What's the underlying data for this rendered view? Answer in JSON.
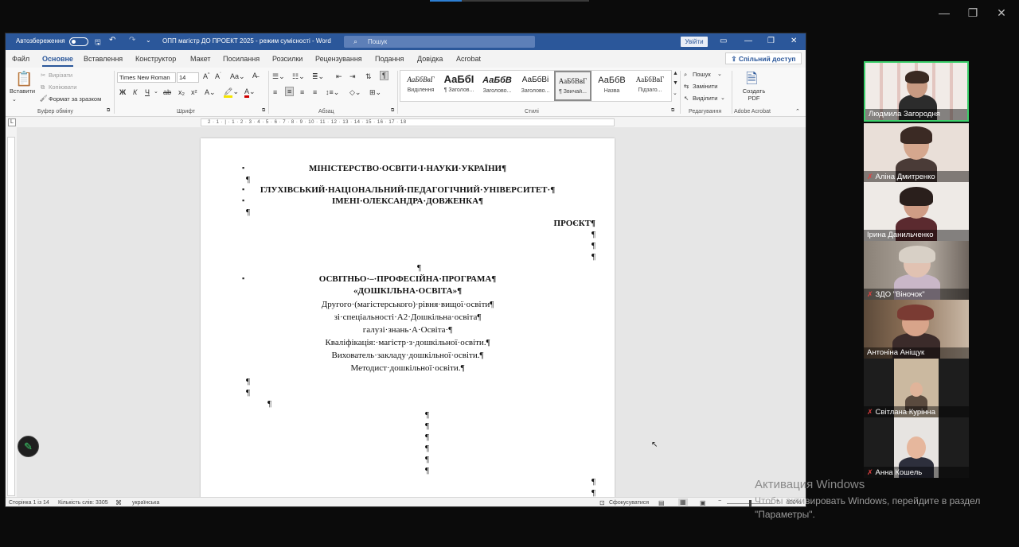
{
  "word": {
    "autosave_label": "Автозбереження",
    "doc_title": "ОПП магістр ДО ПРОЕКТ 2025  -  режим сумісності  -  Word",
    "search_placeholder": "Пошук",
    "signin_label": "Увійти",
    "share_label": "Спільний доступ",
    "menu": [
      "Файл",
      "Основне",
      "Вставлення",
      "Конструктор",
      "Макет",
      "Посилання",
      "Розсилки",
      "Рецензування",
      "Подання",
      "Довідка",
      "Acrobat"
    ],
    "ribbon": {
      "paste": "Вставити",
      "cut": "Вирізати",
      "copy": "Копіювати",
      "format_painter": "Формат за зразком",
      "clipboard_group": "Буфер обміну",
      "font_name": "Times New Roman",
      "font_size": "14",
      "font_group": "Шрифт",
      "paragraph_group": "Абзац",
      "styles_group": "Стилі",
      "find": "Пошук",
      "replace": "Замінити",
      "select": "Виділити",
      "editing_group": "Редагування",
      "create_pdf": "Создать PDF",
      "acrobat_group": "Adobe Acrobat",
      "styles": [
        {
          "preview": "АаБбВвГ",
          "name": "Виділення"
        },
        {
          "preview": "АаБбІ",
          "name": "¶ Заголов..."
        },
        {
          "preview": "АаБбВ",
          "name": "Заголово..."
        },
        {
          "preview": "АаБбВі",
          "name": "Заголово..."
        },
        {
          "preview": "АаБбВвГ",
          "name": "¶ Звичай..."
        },
        {
          "preview": "АаБбВ",
          "name": "Назва"
        },
        {
          "preview": "АаБбВвГ",
          "name": "Підзаго..."
        }
      ]
    },
    "ruler_numbers": "2 · 1 · | · 1 · 2 · 3 · 4 · 5 · 6 · 7 · 8 · 9 · 10 · 11 · 12 · 13 · 14 · 15 · 16 · 17 · 18",
    "document": {
      "line1": "МІНІСТЕРСТВО·ОСВІТИ·І·НАУКИ·УКРАЇНИ¶",
      "line2": "ГЛУХІВСЬКИЙ·НАЦІОНАЛЬНИЙ·ПЕДАГОГІЧНИЙ·УНІВЕРСИТЕТ·¶",
      "line3": "ІМЕНІ·ОЛЕКСАНДРА·ДОВЖЕНКА¶",
      "line4": "ПРОЄКТ¶",
      "line5": "ОСВІТНЬО·–·ПРОФЕСІЙНА·ПРОГРАМА¶",
      "line6": "«ДОШКІЛЬНА·ОСВІТА»¶",
      "line7": "Другого·(магістерського)·рівня·вищої·освіти¶",
      "line8": "зі·спеціальності·А2·Дошкільна·освіта¶",
      "line9": "галузі·знань·А·Освіта·¶",
      "line10": "Кваліфікація:·магістр·з·дошкільної·освіти.¶",
      "line11": "Вихователь·закладу·дошкільної·освіти.¶",
      "line12": "Методист·дошкільної·освіти.¶",
      "pilcrow": "¶"
    },
    "status": {
      "page": "Сторінка 1 із 14",
      "words": "Кількість слів: 3305",
      "language": "українська",
      "focus": "Сфокусуватися",
      "zoom": "100%"
    }
  },
  "participants": [
    {
      "name": "Людмила Загородня",
      "muted": false,
      "active": true
    },
    {
      "name": "Аліна Дмитренко",
      "muted": true,
      "active": false
    },
    {
      "name": "Ірина  Данильченко",
      "muted": false,
      "active": false
    },
    {
      "name": "ЗДО \"Віночок\"",
      "muted": true,
      "active": false
    },
    {
      "name": "Антоніна Аніщук",
      "muted": false,
      "active": false
    },
    {
      "name": "Світлана Курінна",
      "muted": true,
      "active": false
    },
    {
      "name": "Анна Кошель",
      "muted": true,
      "active": false
    }
  ],
  "windows_activation": {
    "title": "Активация Windows",
    "line1": "Чтобы активировать Windows, перейдите в раздел",
    "line2": "\"Параметры\"."
  },
  "colors": {
    "word_blue": "#2b579a",
    "active_speaker": "#3ccf6a",
    "muted_mic": "#e04040"
  }
}
